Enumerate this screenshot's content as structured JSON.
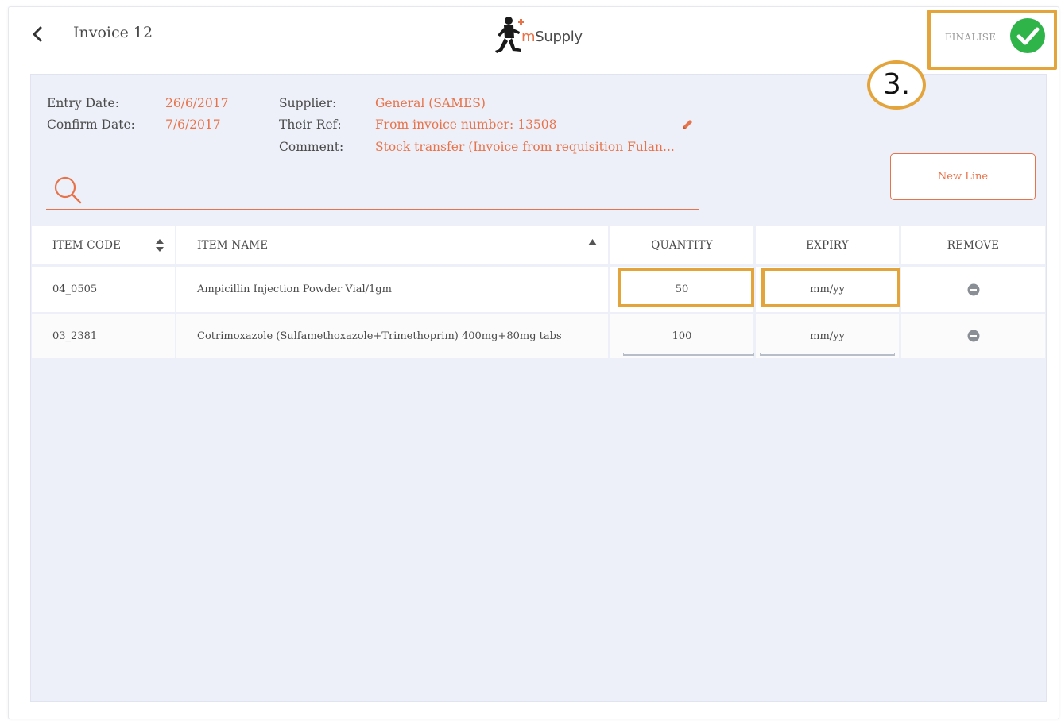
{
  "header": {
    "title": "Invoice 12",
    "logo_text_m": "m",
    "logo_text_rest": "Supply",
    "finalise_label": "FINALISE"
  },
  "annotation": {
    "step": "3."
  },
  "details": {
    "entry_date_label": "Entry Date:",
    "entry_date_value": "26/6/2017",
    "confirm_date_label": "Confirm Date:",
    "confirm_date_value": "7/6/2017",
    "supplier_label": "Supplier:",
    "supplier_value": "General (SAMES)",
    "their_ref_label": "Their Ref:",
    "their_ref_value": "From invoice number: 13508",
    "comment_label": "Comment:",
    "comment_value": "Stock transfer (Invoice from requisition Fulan..."
  },
  "search": {
    "placeholder": ""
  },
  "new_line_label": "New Line",
  "table": {
    "headers": [
      "ITEM CODE",
      "ITEM NAME",
      "QUANTITY",
      "EXPIRY",
      "REMOVE"
    ],
    "rows": [
      {
        "code": "04_0505",
        "name": "Ampicillin Injection Powder Vial/1gm",
        "quantity": "50",
        "expiry": "mm/yy"
      },
      {
        "code": "03_2381",
        "name": "Cotrimoxazole (Sulfamethoxazole+Trimethoprim) 400mg+80mg tabs",
        "quantity": "100",
        "expiry": "mm/yy"
      }
    ]
  },
  "colors": {
    "accent": "#e8734a",
    "highlight": "#e3a43c",
    "finalise_green": "#2fb44a",
    "panel_bg": "#edf0f8"
  },
  "icons": [
    "chevron-left-icon",
    "msupply-logo",
    "check-circle-icon",
    "pencil-icon",
    "search-icon",
    "sort-icon",
    "sort-ascending-icon",
    "remove-icon"
  ]
}
